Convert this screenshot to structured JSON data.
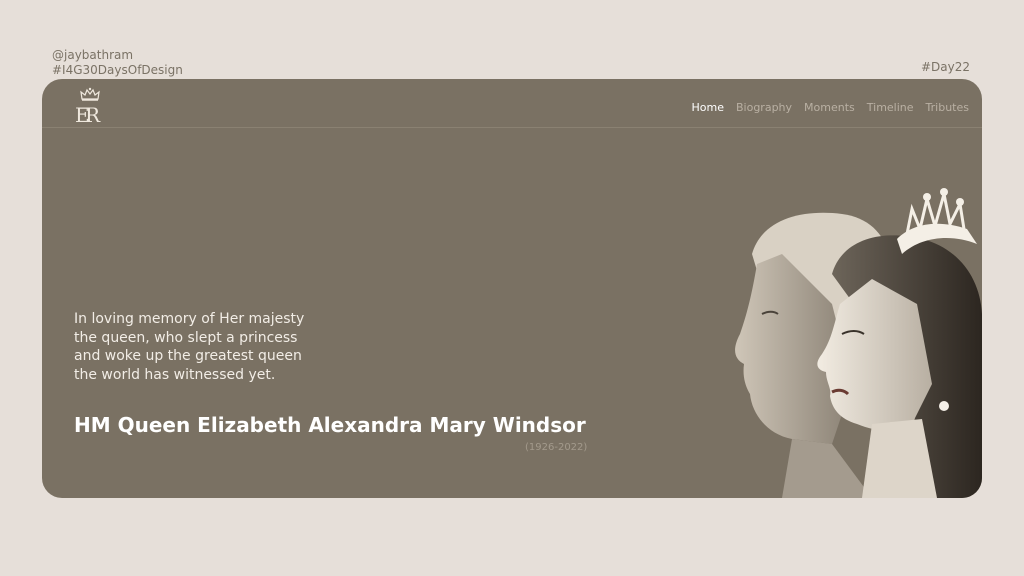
{
  "meta": {
    "handle": "@jaybathram",
    "hashtag": "#I4G30DaysOfDesign",
    "day": "#Day22"
  },
  "nav": {
    "items": [
      {
        "label": "Home",
        "active": true
      },
      {
        "label": "Biography",
        "active": false
      },
      {
        "label": "Moments",
        "active": false
      },
      {
        "label": "Timeline",
        "active": false
      },
      {
        "label": "Tributes",
        "active": false
      }
    ]
  },
  "hero": {
    "tagline_lines": [
      "In loving memory of Her majesty",
      "the queen, who slept a princess",
      "and woke up the greatest queen",
      "the world has witnessed yet."
    ],
    "name": "HM Queen Elizabeth Alexandra Mary Windsor",
    "years": "(1926-2022)"
  },
  "colors": {
    "page_bg": "#e6dfd9",
    "card_bg": "#7a7163",
    "nav_active": "#ffffff",
    "nav_inactive": "#b9b0a3"
  }
}
